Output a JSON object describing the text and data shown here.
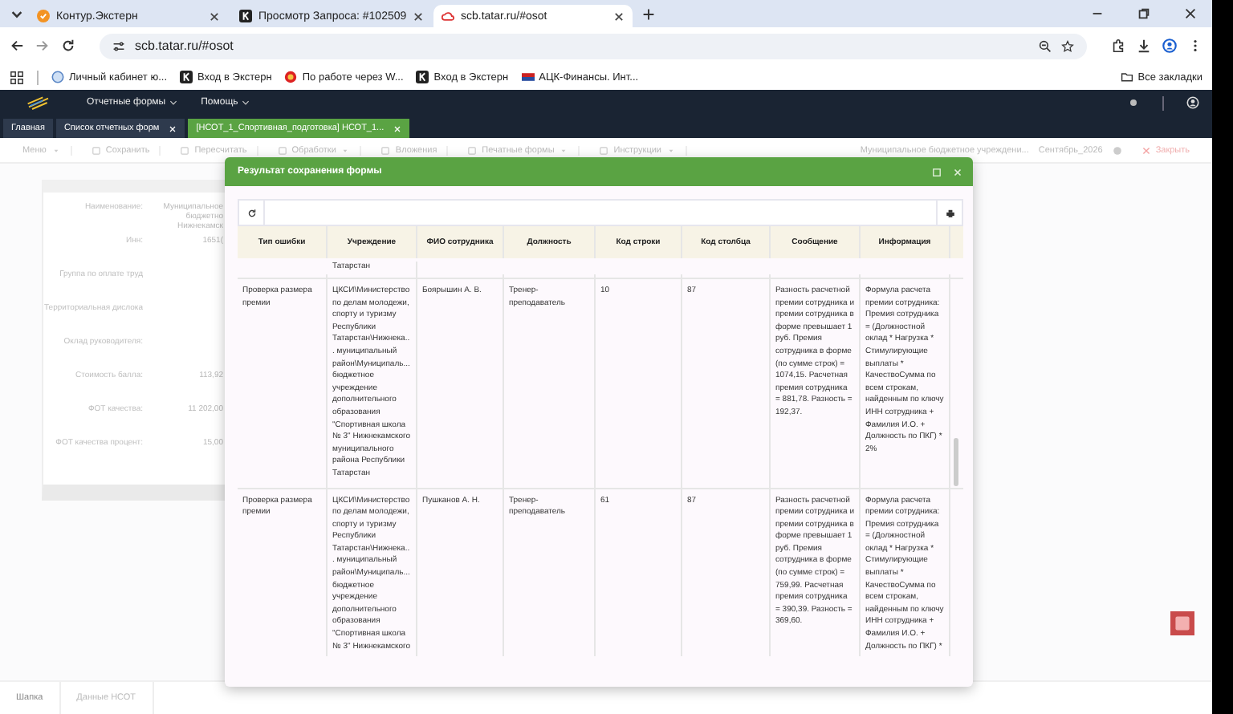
{
  "browser": {
    "tabs": [
      {
        "title": "Контур.Экстерн",
        "selected": false
      },
      {
        "title": "Просмотр Запроса: #102509",
        "selected": false
      },
      {
        "title": "scb.tatar.ru/#osot",
        "selected": true
      }
    ],
    "address": "scb.tatar.ru/#osot",
    "bookmarks": [
      "Личный кабинет ю...",
      "Вход в Экстерн",
      "По работе через W...",
      "Вход в Экстерн",
      "АЦК-Финансы. Инт..."
    ],
    "all_bookmarks": "Все закладки"
  },
  "app": {
    "menu": [
      "Отчетные формы",
      "Помощь"
    ],
    "tabs": [
      {
        "label": "Главная",
        "selected": false,
        "closable": false
      },
      {
        "label": "Список отчетных форм",
        "selected": false,
        "closable": true
      },
      {
        "label": "[НСОТ_1_Спортивная_подготовка] НСОТ_1...",
        "selected": true,
        "closable": true
      }
    ],
    "toolbar": [
      {
        "label": "Меню",
        "dropdown": true
      },
      {
        "label": "Сохранить",
        "dropdown": false
      },
      {
        "label": "Пересчитать",
        "dropdown": false
      },
      {
        "label": "Обработки",
        "dropdown": true
      },
      {
        "label": "Вложения",
        "dropdown": false
      },
      {
        "label": "Печатные формы",
        "dropdown": true
      },
      {
        "label": "Инструкции",
        "dropdown": true
      }
    ],
    "organization": "Муниципальное бюджетное учреждени...",
    "period": "Сентябрь_2026",
    "close": "Закрыть"
  },
  "form": {
    "fields": [
      {
        "label": "Наименование:",
        "value": "Муниципальное бюджетно\nНижнекамск"
      },
      {
        "label": "Инн:",
        "value": "1651("
      },
      {
        "label": "Группа по оплате труд"
      },
      {
        "label": "Территориальная дислока"
      },
      {
        "label": "Оклад руководителя:"
      },
      {
        "label": "Стоимость балла:",
        "value": "113,92"
      },
      {
        "label": "ФОТ качества:",
        "value": "11 202,00"
      },
      {
        "label": "ФОТ качества процент:",
        "value": "15,00"
      }
    ],
    "bottom_tabs": [
      {
        "label": "Шапка",
        "selected": true
      },
      {
        "label": "Данные НСОТ",
        "selected": false
      }
    ]
  },
  "modal": {
    "title": "Результат сохранения формы",
    "columns": [
      "Тип ошибки",
      "Учреждение",
      "ФИО сотрудника",
      "Должность",
      "Код строки",
      "Код столбца",
      "Сообщение",
      "Информация"
    ],
    "rows": [
      {
        "partial": true,
        "cells": [
          "",
          "Татарстан",
          "",
          "",
          "",
          "",
          "",
          ""
        ]
      },
      {
        "partial": false,
        "cells": [
          "Проверка размера премии",
          "ЦКСИ\\Министерство по делам молодежи, спорту и туризму Республики Татарстан\\Нижнека... муниципальный район\\Муниципаль... бюджетное учреждение дополнительного образования \"Спортивная школа № 3\" Нижнекамского муниципального района Республики Татарстан",
          "Боярышин А. В.",
          "Тренер-преподаватель",
          "10",
          "87",
          "Разность расчетной премии сотрудника и премии сотрудника в форме превышает 1 руб. Премия сотрудника в форме (по сумме строк) = 1074,15. Расчетная премия сотрудника = 881,78. Разность = 192,37.",
          "Формула расчета премии сотрудника: Премия сотрудника = (Должностной оклад * Нагрузка * Стимулирующие выплаты * КачествоСумма по всем строкам, найденным по ключу ИНН сотрудника + Фамилия И.О. + Должность по ПКГ) * 2%"
        ]
      },
      {
        "partial": false,
        "cells": [
          "Проверка размера премии",
          "ЦКСИ\\Министерство по делам молодежи, спорту и туризму Республики Татарстан\\Нижнека... муниципальный район\\Муниципаль... бюджетное учреждение дополнительного образования \"Спортивная школа № 3\" Нижнекамского",
          "Пушканов А. Н.",
          "Тренер-преподаватель",
          "61",
          "87",
          "Разность расчетной премии сотрудника и премии сотрудника в форме превышает 1 руб. Премия сотрудника в форме (по сумме строк) = 759,99. Расчетная премия сотрудника = 390,39. Разность = 369,60.",
          "Формула расчета премии сотрудника: Премия сотрудника = (Должностной оклад * Нагрузка * Стимулирующие выплаты * КачествоСумма по всем строкам, найденным по ключу ИНН сотрудника + Фамилия И.О. + Должность по ПКГ) *"
        ]
      }
    ]
  }
}
